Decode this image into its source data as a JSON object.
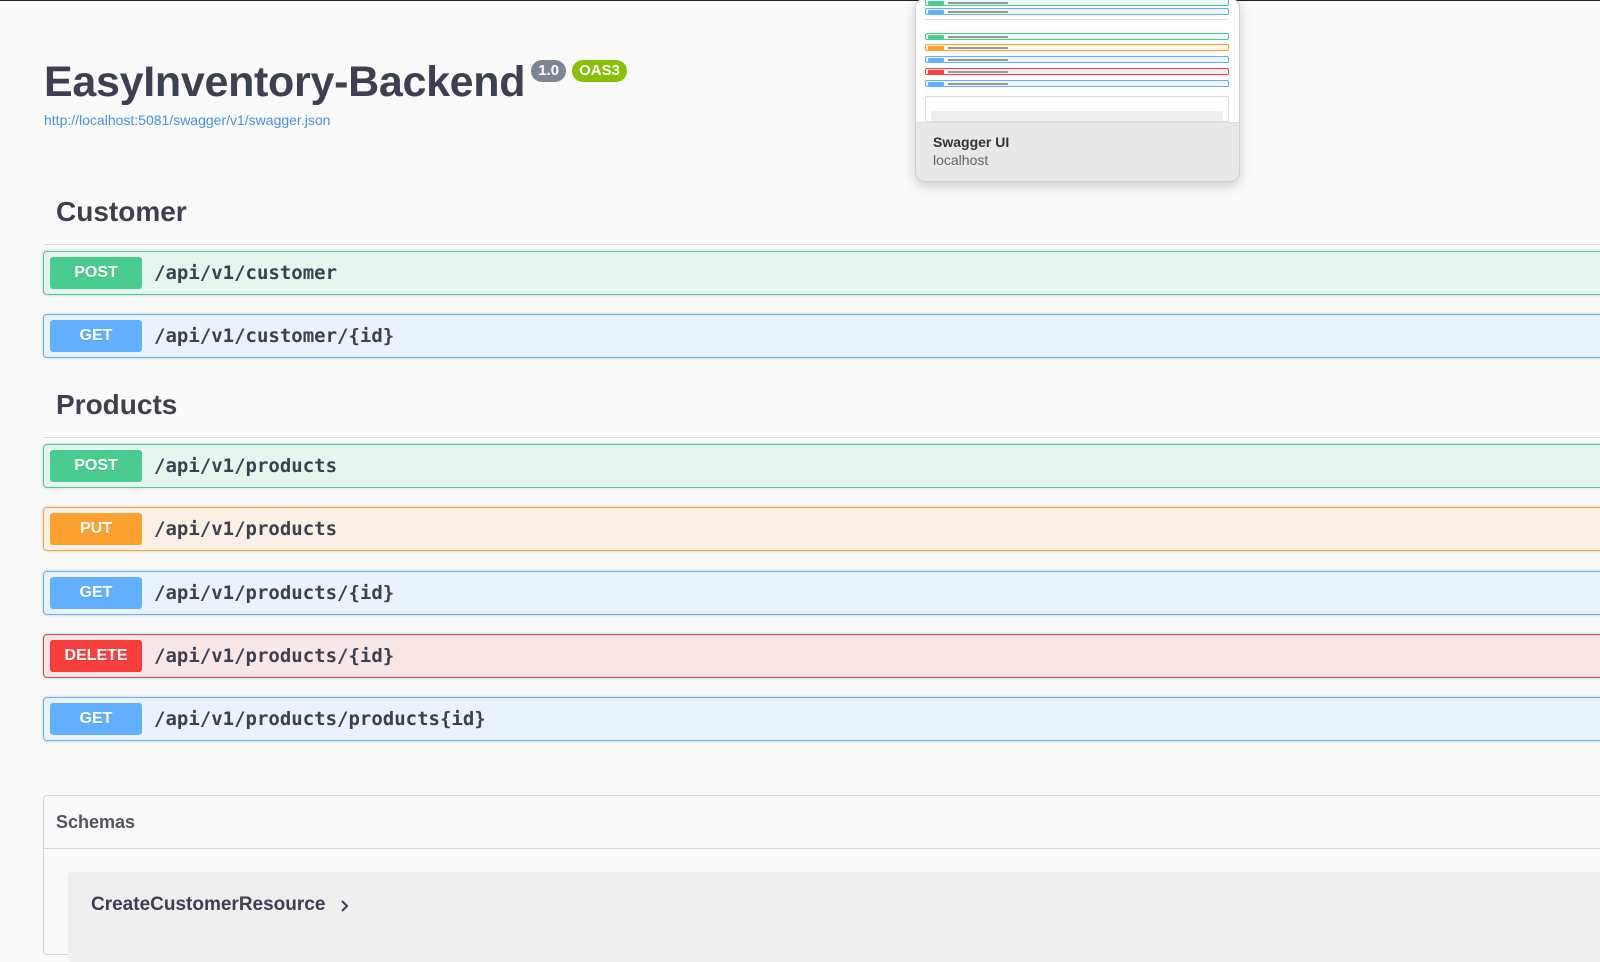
{
  "info": {
    "title": "EasyInventory-Backend",
    "version": "1.0",
    "oas": "OAS3",
    "spec_url": "http://localhost:5081/swagger/v1/swagger.json"
  },
  "tags": [
    {
      "name": "Customer",
      "operations": [
        {
          "method": "POST",
          "path": "/api/v1/customer"
        },
        {
          "method": "GET",
          "path": "/api/v1/customer/{id}"
        }
      ]
    },
    {
      "name": "Products",
      "operations": [
        {
          "method": "POST",
          "path": "/api/v1/products"
        },
        {
          "method": "PUT",
          "path": "/api/v1/products"
        },
        {
          "method": "GET",
          "path": "/api/v1/products/{id}"
        },
        {
          "method": "DELETE",
          "path": "/api/v1/products/{id}"
        },
        {
          "method": "GET",
          "path": "/api/v1/products/products{id}"
        }
      ]
    }
  ],
  "schemas": {
    "title": "Schemas",
    "items": [
      "CreateCustomerResource"
    ]
  },
  "tab_preview": {
    "title": "Swagger UI",
    "host": "localhost"
  },
  "colors": {
    "post": "#49cc90",
    "get": "#61affe",
    "put": "#fca130",
    "delete": "#f93e3e",
    "link": "#4990e2"
  }
}
